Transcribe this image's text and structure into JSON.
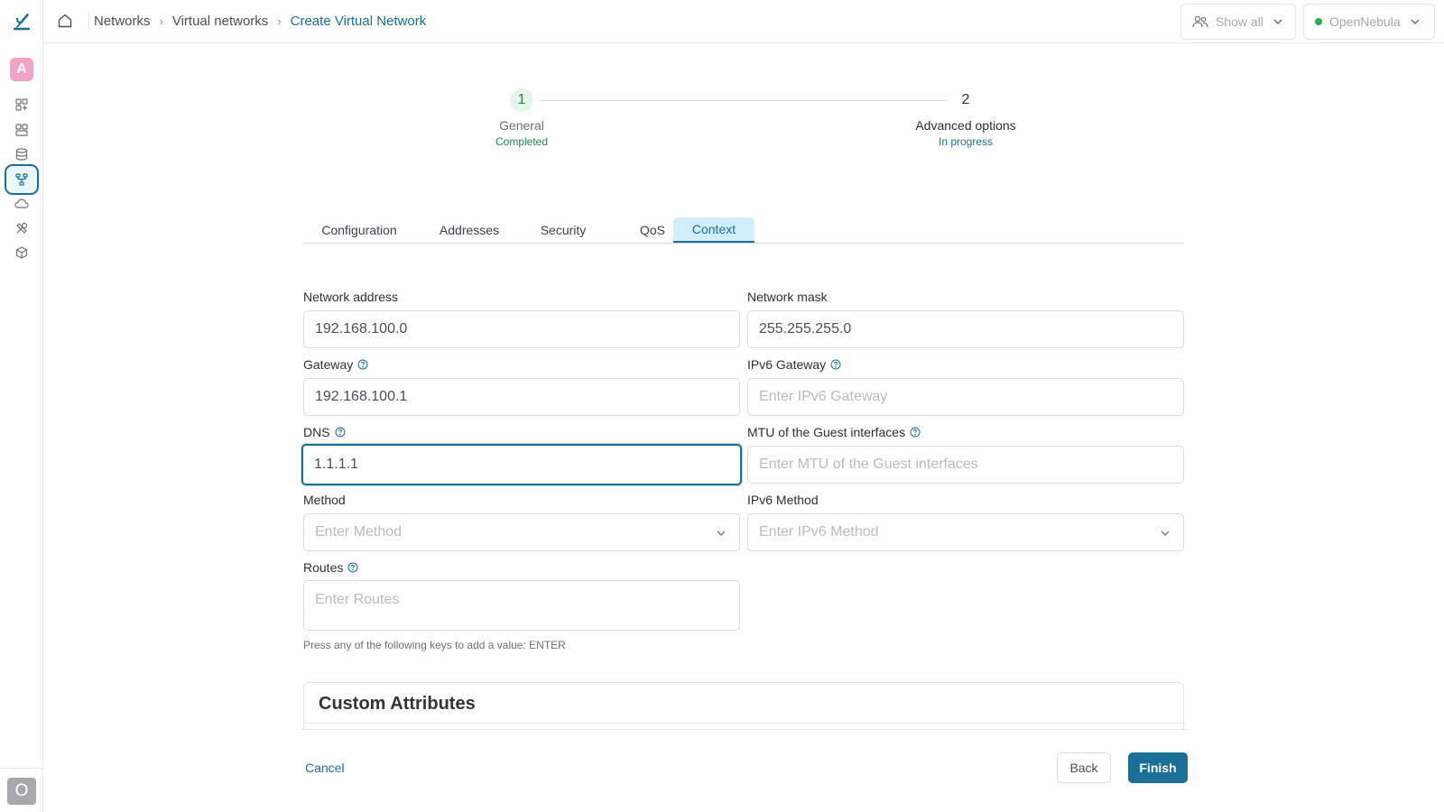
{
  "sidebar": {
    "avatar_letter": "A",
    "nav_icons": [
      "dashboard-icon",
      "instances-icon",
      "storage-icon",
      "networks-icon",
      "cloud-icon",
      "tools-icon",
      "system-icon"
    ],
    "active_icon": "networks-icon",
    "user_letter": "O"
  },
  "breadcrumb": {
    "items": [
      "Networks",
      "Virtual networks",
      "Create Virtual Network"
    ]
  },
  "topbar": {
    "group_select": "Show all",
    "zone_select": "OpenNebula",
    "zone_status_color": "#24b34b"
  },
  "stepper": {
    "steps": [
      {
        "number": "1",
        "title": "General",
        "status": "Completed"
      },
      {
        "number": "2",
        "title": "Advanced options",
        "status": "In progress"
      }
    ]
  },
  "tabs": {
    "items": [
      "Configuration",
      "Addresses",
      "Security",
      "QoS",
      "Context"
    ],
    "active": "Context"
  },
  "form": {
    "network_address": {
      "label": "Network address",
      "value": "192.168.100.0"
    },
    "network_mask": {
      "label": "Network mask",
      "value": "255.255.255.0"
    },
    "gateway": {
      "label": "Gateway",
      "value": "192.168.100.1"
    },
    "ipv6_gateway": {
      "label": "IPv6 Gateway",
      "value": "",
      "placeholder": "Enter IPv6 Gateway"
    },
    "dns": {
      "label": "DNS",
      "value": "1.1.1.1"
    },
    "mtu": {
      "label": "MTU of the Guest interfaces",
      "value": "",
      "placeholder": "Enter MTU of the Guest interfaces"
    },
    "method": {
      "label": "Method",
      "placeholder": "Enter Method"
    },
    "ipv6_method": {
      "label": "IPv6 Method",
      "placeholder": "Enter IPv6 Method"
    },
    "routes": {
      "label": "Routes",
      "placeholder": "Enter Routes",
      "hint": "Press any of the following keys to add a value: ENTER"
    }
  },
  "custom_attributes": {
    "title": "Custom Attributes"
  },
  "footer": {
    "cancel": "Cancel",
    "back": "Back",
    "finish": "Finish"
  },
  "colors": {
    "accent": "#1a6f96",
    "success": "#1f8a44",
    "active_tab_bg": "#d2eefa"
  }
}
